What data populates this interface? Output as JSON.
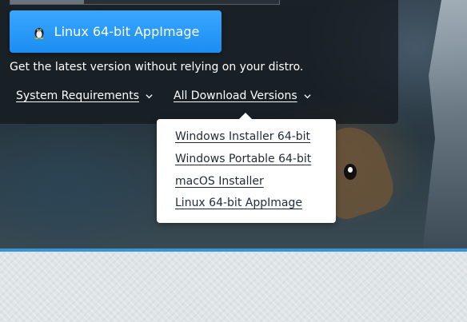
{
  "download": {
    "primary_label": "Linux 64-bit AppImage",
    "icon": "tux-icon"
  },
  "tagline": "Get the latest version without relying on your distro.",
  "nav": {
    "system_requirements": "System Requirements",
    "all_versions": "All Download Versions"
  },
  "dropdown": {
    "items": [
      "Windows Installer 64-bit",
      "Windows Portable 64-bit",
      "macOS Installer",
      "Linux 64-bit AppImage"
    ]
  },
  "colors": {
    "button_blue": "#1b8ef2",
    "divider_blue": "#3a95d8",
    "panel_dark": "#14181c",
    "dropdown_text": "#1f2a36"
  }
}
